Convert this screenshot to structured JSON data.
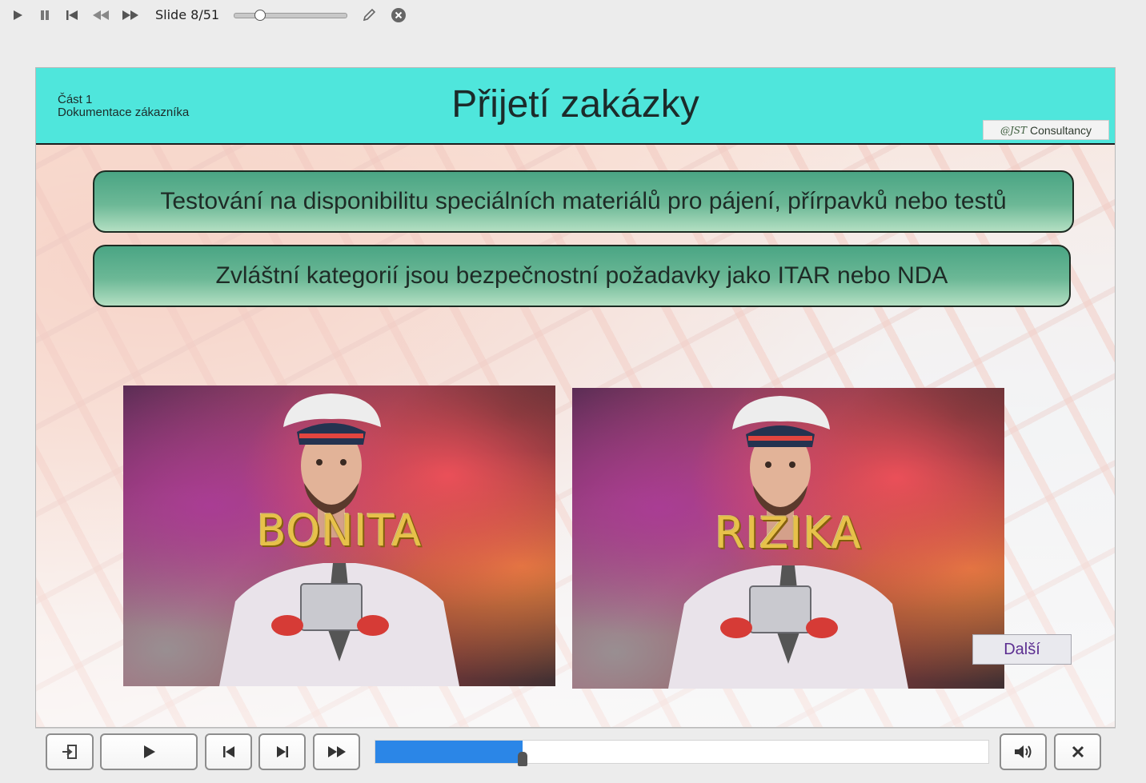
{
  "toolbar": {
    "slide_counter": "Slide 8/51",
    "slider_position": 0.23,
    "icons": [
      "play-icon",
      "pause-icon",
      "skip-start-icon",
      "rewind-icon",
      "fast-forward-icon",
      "pen-icon",
      "close-circle-icon"
    ]
  },
  "slide": {
    "section_number": "Část 1",
    "section_name": "Dokumentace zákazníka",
    "title": "Přijetí zakázky",
    "logo_mark": "@JST",
    "logo_text": "Consultancy",
    "info_boxes": [
      "Testování na disponibilitu speciálních materiálů pro pájení, přírpavků nebo testů",
      "Zvláštní kategorií jsou bezpečnostní požadavky jako ITAR nebo NDA"
    ],
    "images": [
      {
        "word": "BONITA"
      },
      {
        "word": "RIZIKA"
      }
    ],
    "next_button": "Další"
  },
  "player": {
    "progress": 0.24,
    "icons": [
      "exit-icon",
      "play-icon",
      "previous-icon",
      "next-icon",
      "fast-forward-icon",
      "volume-icon",
      "close-icon"
    ]
  },
  "colors": {
    "header_bg": "#4fe6dc",
    "box_green": "#6cb896",
    "progress_blue": "#2b86e7",
    "next_button_text": "#5c2e91"
  }
}
